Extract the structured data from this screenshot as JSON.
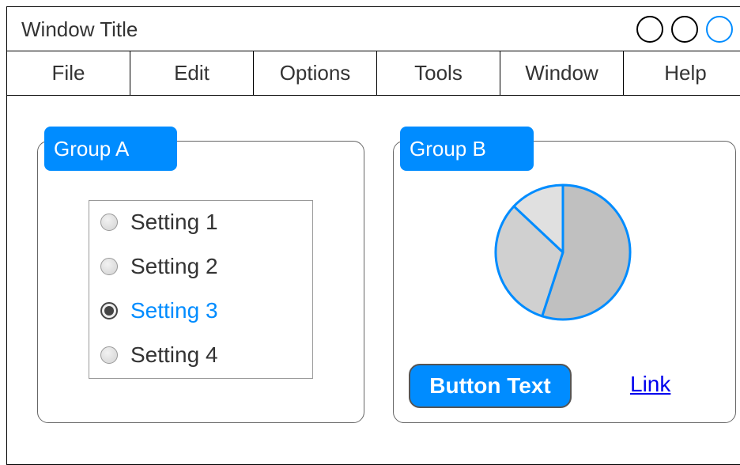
{
  "window": {
    "title": "Window Title",
    "controls": [
      "window-control-1",
      "window-control-2",
      "window-control-3"
    ]
  },
  "menu": {
    "items": [
      "File",
      "Edit",
      "Options",
      "Tools",
      "Window",
      "Help"
    ]
  },
  "groupA": {
    "title": "Group A",
    "settings": [
      {
        "label": "Setting 1",
        "checked": false
      },
      {
        "label": "Setting 2",
        "checked": false
      },
      {
        "label": "Setting 3",
        "checked": true
      },
      {
        "label": "Setting 4",
        "checked": false
      }
    ]
  },
  "groupB": {
    "title": "Group B",
    "button_label": "Button Text",
    "link_label": "Link"
  },
  "chart_data": {
    "type": "pie",
    "values": [
      55,
      32,
      13
    ],
    "colors": [
      "#c0c0c0",
      "#d0d0d0",
      "#e0e0e0"
    ],
    "stroke": "#008cff"
  },
  "colors": {
    "accent": "#008cff",
    "text": "#333333",
    "link": "#0000ee"
  }
}
